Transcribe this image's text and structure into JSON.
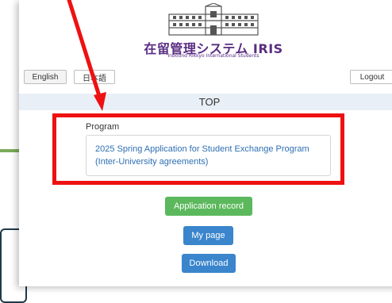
{
  "app": {
    "title": "在留管理システム IRIS",
    "subtitle": "Inbound Rikkyo International Students"
  },
  "header": {
    "lang_en": "English",
    "lang_jp": "日本語",
    "logout": "Logout"
  },
  "page": {
    "title": "TOP"
  },
  "program": {
    "label": "Program",
    "line1": "2025 Spring Application for Student Exchange Program",
    "line2": "(Inter-University agreements)"
  },
  "actions": {
    "application_record": "Application record",
    "my_page": "My page",
    "download": "Download"
  },
  "colors": {
    "brand_purple": "#5a2d82",
    "highlight_red": "#ee1111",
    "green_button": "#5cb85c",
    "blue_button": "#3a85cc",
    "link_blue": "#2e6fb3"
  }
}
